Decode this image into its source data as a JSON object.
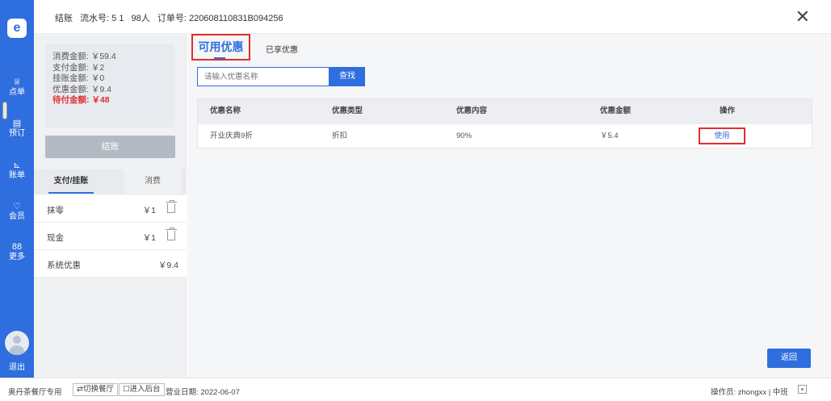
{
  "sidebar": {
    "logo": "e",
    "items": [
      {
        "label": "点单",
        "icon": "♕"
      },
      {
        "label": "预订",
        "icon": "▤"
      },
      {
        "label": "账单",
        "icon": "⊾"
      },
      {
        "label": "会员",
        "icon": "♡"
      },
      {
        "label": "更多",
        "icon": "88"
      }
    ],
    "logout": "退出"
  },
  "header": {
    "checkout": "结账",
    "serial": "流水号: 5 1",
    "guests": "98人",
    "order": "订单号: 220608110831B094256",
    "close": "✕"
  },
  "summary": {
    "consume": "消费金额: ￥59.4",
    "paid": "支付金额: ￥2",
    "credit": "挂账金额: ￥0",
    "discount": "优惠金额: ￥9.4",
    "due": "待付金额: ￥48"
  },
  "checkout_button": "结账",
  "pay_tabs": {
    "active": "支付/挂账",
    "inactive": "消费"
  },
  "payments": [
    {
      "name": "抹零",
      "amount": "￥1"
    },
    {
      "name": "现金",
      "amount": "￥1"
    },
    {
      "name": "系统优惠",
      "amount": "￥9.4"
    }
  ],
  "discount_tabs": {
    "available": "可用优惠",
    "enjoyed": "已享优惠"
  },
  "search": {
    "placeholder": "请输入优惠名称",
    "button": "查找"
  },
  "table": {
    "headers": [
      "优惠名称",
      "优惠类型",
      "优惠内容",
      "优惠金额",
      "操作"
    ],
    "rows": [
      {
        "name": "开业庆典9折",
        "type": "折扣",
        "content": "90%",
        "amount": "￥5.4",
        "action": "使用"
      }
    ]
  },
  "back_button": "返回",
  "footer": {
    "brand": "奥丹茶餐厅专用",
    "switch": "⇄切换餐厅",
    "backend": "☐进入后台",
    "business_date": "营业日期: 2022-06-07",
    "operator": "操作员: zhongxx | 中班"
  },
  "colors": {
    "primary": "#2f6ede",
    "highlight": "#e22d2d"
  }
}
